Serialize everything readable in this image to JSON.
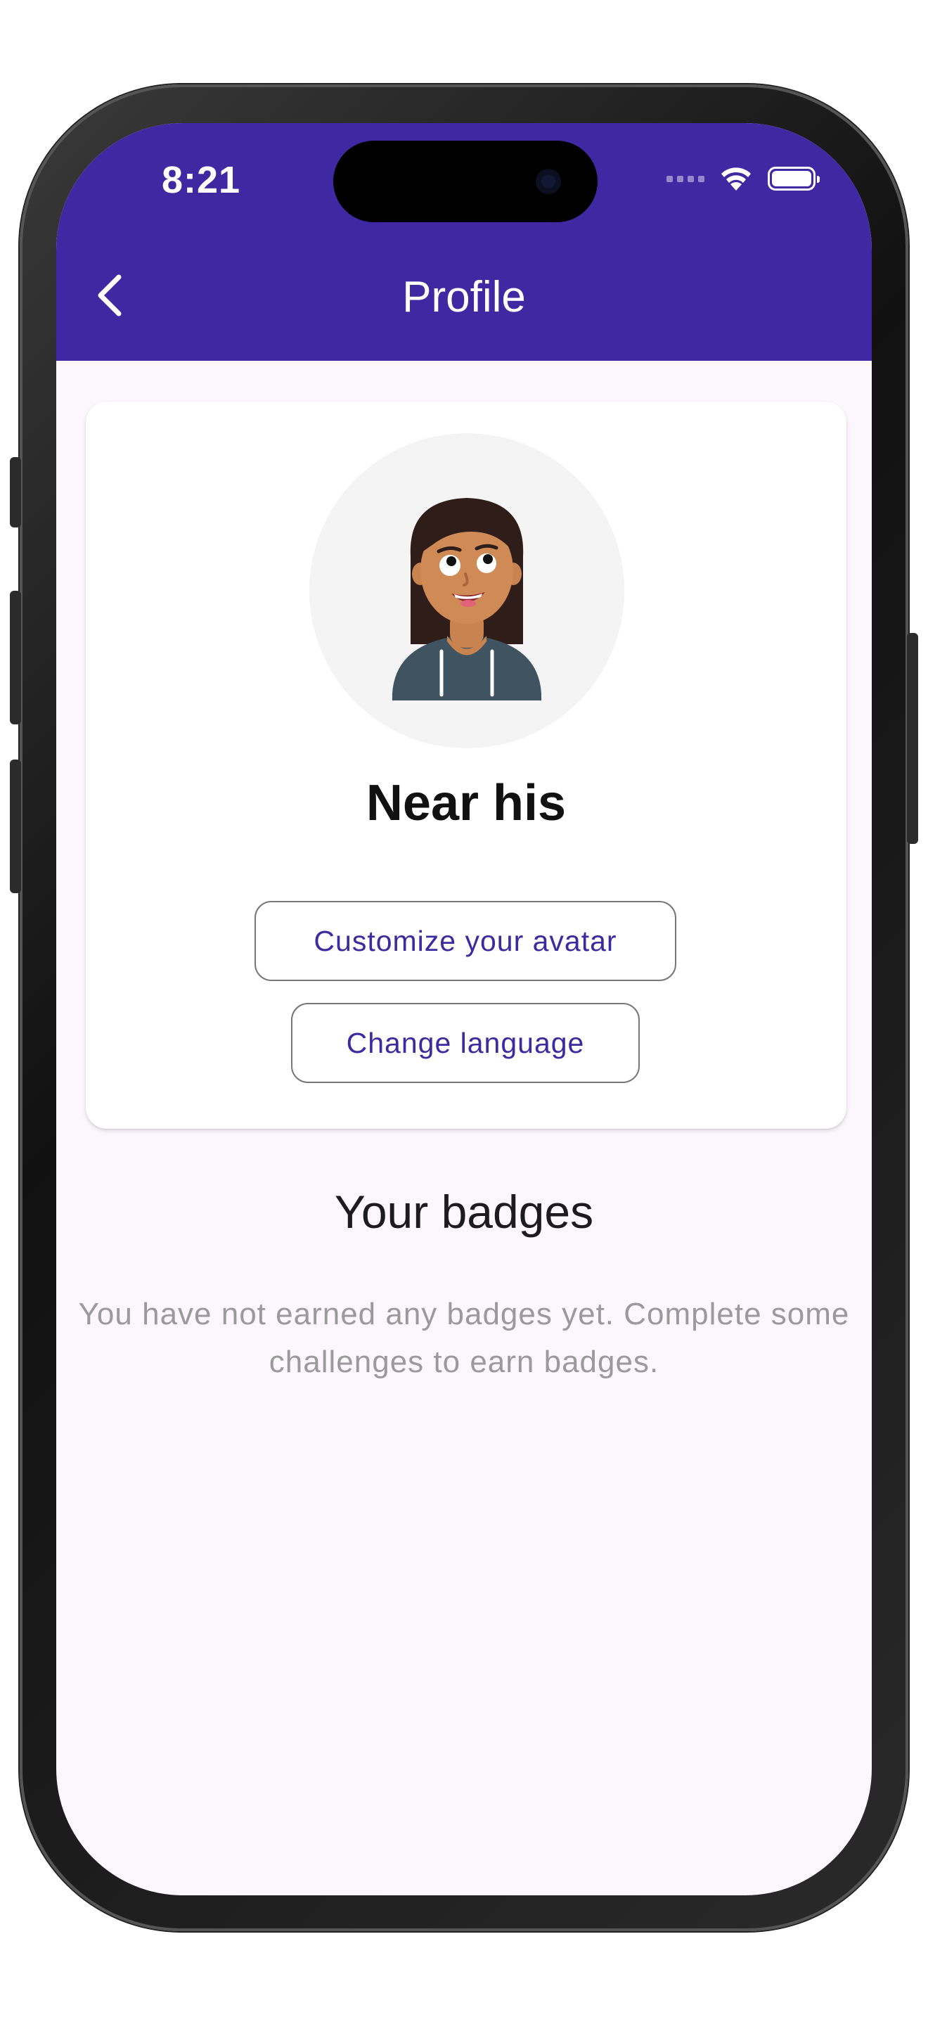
{
  "status_bar": {
    "time": "8:21"
  },
  "app_bar": {
    "title": "Profile",
    "back_icon": "chevron-left-icon",
    "background_color": "#3f29a3"
  },
  "profile": {
    "name": "Near his",
    "customize_avatar_label": "Customize your avatar",
    "change_language_label": "Change language"
  },
  "badges": {
    "heading": "Your badges",
    "empty_message": "You have not earned any badges yet. Complete some challenges to earn badges."
  },
  "colors": {
    "accent": "#3f29a3",
    "button_text": "#3a2ca0",
    "page_background": "#fcf6fd",
    "muted_text": "#9a9a9a"
  }
}
